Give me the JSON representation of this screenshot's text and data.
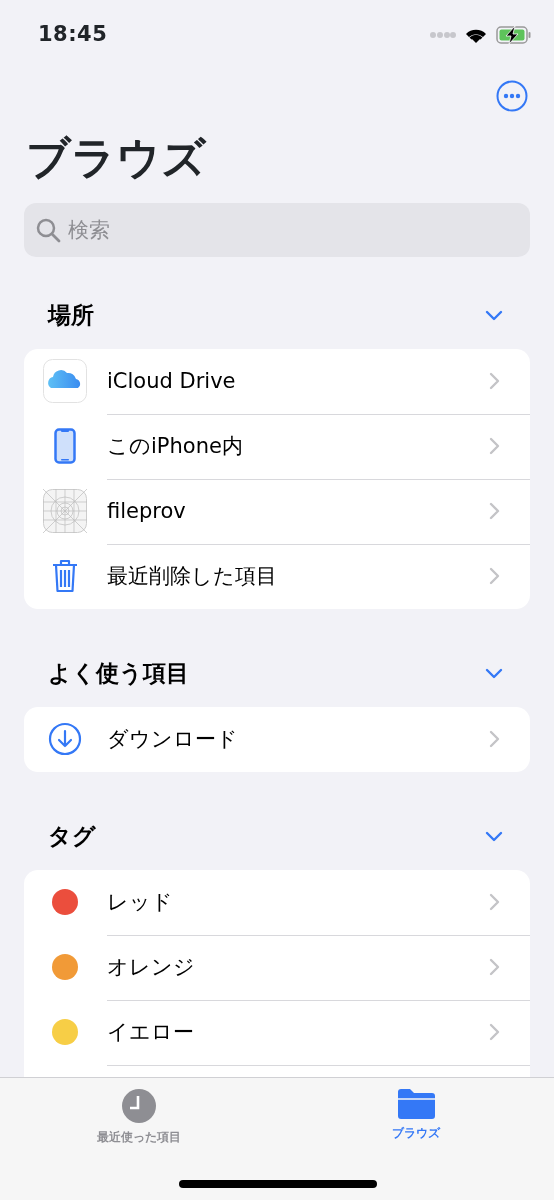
{
  "status_bar": {
    "time": "18:45"
  },
  "title": "ブラウズ",
  "search": {
    "placeholder": "検索"
  },
  "sections": [
    {
      "title": "場所",
      "expanded": true,
      "items": [
        {
          "kind": "icloud",
          "label": "iCloud Drive"
        },
        {
          "kind": "iphone",
          "label": "このiPhone内"
        },
        {
          "kind": "app",
          "label": "fileprov"
        },
        {
          "kind": "trash",
          "label": "最近削除した項目"
        }
      ]
    },
    {
      "title": "よく使う項目",
      "expanded": true,
      "items": [
        {
          "kind": "download",
          "label": "ダウンロード"
        }
      ]
    },
    {
      "title": "タグ",
      "expanded": true,
      "items": [
        {
          "kind": "tag",
          "label": "レッド",
          "color": "#eb4e3d"
        },
        {
          "kind": "tag",
          "label": "オレンジ",
          "color": "#f19a37"
        },
        {
          "kind": "tag",
          "label": "イエロー",
          "color": "#f7ce46"
        }
      ]
    }
  ],
  "tab_bar": [
    {
      "kind": "recents",
      "label": "最近使った項目",
      "selected": false
    },
    {
      "kind": "browse",
      "label": "ブラウズ",
      "selected": true
    }
  ]
}
